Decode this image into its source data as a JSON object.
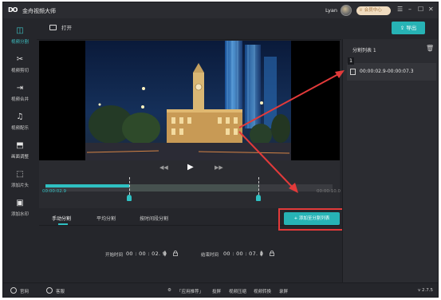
{
  "app": {
    "title": "金舟视频大师",
    "logo": "DO"
  },
  "user": {
    "name": "Lyan",
    "vip_label": "会员中心"
  },
  "window_controls": {
    "menu": "☰",
    "minimize": "–",
    "maximize": "☐",
    "close": "✕"
  },
  "sidebar": {
    "items": [
      {
        "label": "视频分割",
        "icon": "split-icon",
        "active": true
      },
      {
        "label": "视频剪切",
        "icon": "scissors-icon",
        "active": false
      },
      {
        "label": "视频合并",
        "icon": "merge-icon",
        "active": false
      },
      {
        "label": "视频配乐",
        "icon": "music-icon",
        "active": false
      },
      {
        "label": "画面调整",
        "icon": "crop-icon",
        "active": false
      },
      {
        "label": "添加片头",
        "icon": "intro-icon",
        "active": false
      },
      {
        "label": "添加水印",
        "icon": "watermark-icon",
        "active": false
      }
    ]
  },
  "toolbar": {
    "open_label": "打开",
    "export_label": "导出"
  },
  "player": {
    "prev": "◀◀",
    "play": "▶",
    "next": "▶▶"
  },
  "timeline": {
    "current_time": "00:00:02.9",
    "end_time": "00:00:10.0",
    "start_fraction": 0.29,
    "end_fraction": 0.73
  },
  "tabs": [
    {
      "label": "手动分割",
      "active": true
    },
    {
      "label": "平均分割",
      "active": false
    },
    {
      "label": "按时间段分割",
      "active": false
    }
  ],
  "add_split_label": "+ 添加至分割列表",
  "fields": {
    "start_label": "开始时间",
    "start_value": "00 : 00 : 02. 9",
    "end_label": "结束时间",
    "end_value": "00 : 00 : 07. 3"
  },
  "split_panel": {
    "title": "分割列表 1",
    "items": [
      {
        "index": "1",
        "range": "00:00:02.9-00:00:07.3"
      }
    ]
  },
  "footer": {
    "website": "官网",
    "support": "客服",
    "links": [
      "「应用推荐」",
      "投屏",
      "视频压缩",
      "视频转换",
      "录屏"
    ],
    "version": "v 2.7.5"
  },
  "colors": {
    "accent": "#27b3b5",
    "highlight_box": "#e23a3a",
    "background": "#25262b"
  }
}
